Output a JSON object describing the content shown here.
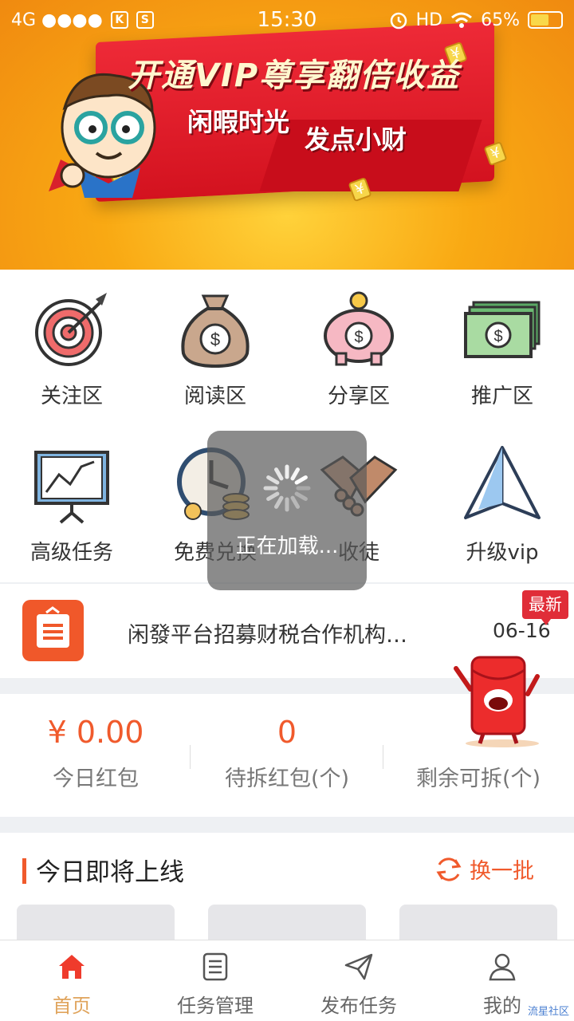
{
  "status_bar": {
    "network": "4G ●●●●",
    "icon_k": "K",
    "icon_s": "S",
    "time": "15:30",
    "hd": "HD",
    "battery": "65%",
    "battery_level": 0.65
  },
  "banner": {
    "title": "开通VIP尊享翻倍收益",
    "subtitle_left": "闲暇时光",
    "subtitle_right": "发点小财",
    "coin_symbol": "¥"
  },
  "menu": {
    "items": [
      {
        "label": "关注区",
        "icon": "target-icon"
      },
      {
        "label": "阅读区",
        "icon": "money-bag-icon"
      },
      {
        "label": "分享区",
        "icon": "piggy-bank-icon"
      },
      {
        "label": "推广区",
        "icon": "cash-stack-icon"
      },
      {
        "label": "高级任务",
        "icon": "chart-board-icon"
      },
      {
        "label": "免费兑换",
        "icon": "clock-coins-icon"
      },
      {
        "label": "收徒",
        "icon": "handshake-icon"
      },
      {
        "label": "升级vip",
        "icon": "paper-plane-icon"
      }
    ]
  },
  "loading": {
    "text": "正在加载..."
  },
  "notice": {
    "text": "闲發平台招募财税合作机构…",
    "date": "06-16",
    "badge": "最新"
  },
  "stats": {
    "items": [
      {
        "value": "¥ 0.00",
        "label": "今日红包"
      },
      {
        "value": "0",
        "label": "待拆红包(个)"
      },
      {
        "value": "",
        "label": "剩余可拆(个)"
      }
    ]
  },
  "upcoming": {
    "title": "今日即将上线",
    "refresh_label": "换一批"
  },
  "tabbar": {
    "tabs": [
      {
        "label": "首页",
        "icon": "home-icon"
      },
      {
        "label": "任务管理",
        "icon": "list-icon"
      },
      {
        "label": "发布任务",
        "icon": "send-icon"
      },
      {
        "label": "我的",
        "icon": "user-icon"
      }
    ]
  },
  "watermark": "流星社区",
  "colors": {
    "accent": "#f05a2c",
    "tab_active": "#e0a45c",
    "badge": "#e02d38"
  }
}
